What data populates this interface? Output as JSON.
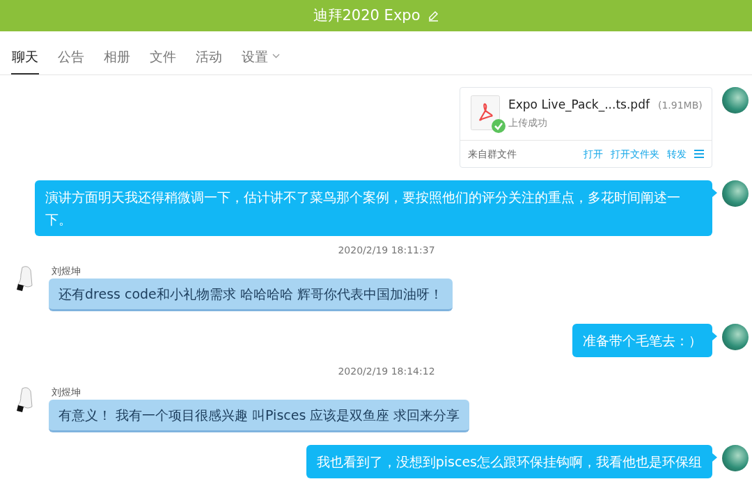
{
  "header": {
    "title": "迪拜2020 Expo"
  },
  "tabs": [
    {
      "label": "聊天",
      "selected": true
    },
    {
      "label": "公告",
      "selected": false
    },
    {
      "label": "相册",
      "selected": false
    },
    {
      "label": "文件",
      "selected": false
    },
    {
      "label": "活动",
      "selected": false
    },
    {
      "label": "设置",
      "selected": false,
      "dropdown": true
    }
  ],
  "messages": [
    {
      "kind": "file",
      "file_name": "Expo Live_Pack_...ts.pdf",
      "size": "(1.91MB)",
      "status": "上传成功",
      "source": "来自群文件",
      "actions": [
        "打开",
        "打开文件夹",
        "转发"
      ]
    },
    {
      "kind": "outgoing",
      "text": "演讲方面明天我还得稍微调一下，估计讲不了菜鸟那个案例，要按照他们的评分关注的重点，多花时间阐述一下。"
    },
    {
      "kind": "time",
      "text": "2020/2/19 18:11:37"
    },
    {
      "kind": "incoming",
      "sender": "刘煜坤",
      "text": "还有dress code和小礼物需求 哈哈哈哈 辉哥你代表中国加油呀！"
    },
    {
      "kind": "outgoing",
      "text": "准备带个毛笔去：）"
    },
    {
      "kind": "time",
      "text": "2020/2/19 18:14:12"
    },
    {
      "kind": "incoming",
      "sender": "刘煜坤",
      "text": "有意义！ 我有一个项目很感兴趣 叫Pisces 应该是双鱼座 求回来分享"
    },
    {
      "kind": "outgoing",
      "text": "我也看到了，没想到pisces怎么跟环保挂钩啊，我看他也是环保组"
    }
  ]
}
